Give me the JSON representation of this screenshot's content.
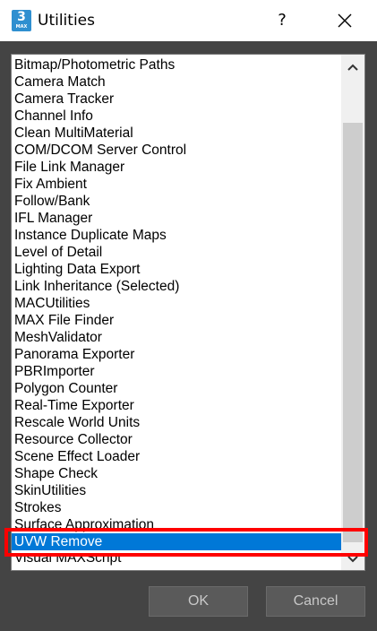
{
  "window": {
    "title": "Utilities",
    "help_label": "?",
    "app_icon": {
      "number": "3",
      "text": "MAX"
    }
  },
  "list": {
    "items": [
      "Bitmap/Photometric Paths",
      "Camera Match",
      "Camera Tracker",
      "Channel Info",
      "Clean MultiMaterial",
      "COM/DCOM Server Control",
      "File Link Manager",
      "Fix Ambient",
      "Follow/Bank",
      "IFL Manager",
      "Instance Duplicate Maps",
      "Level of Detail",
      "Lighting Data Export",
      "Link Inheritance (Selected)",
      "MACUtilities",
      "MAX File Finder",
      "MeshValidator",
      "Panorama Exporter",
      "PBRImporter",
      "Polygon Counter",
      "Real-Time Exporter",
      "Rescale World Units",
      "Resource Collector",
      "Scene Effect Loader",
      "Shape Check",
      "SkinUtilities",
      "Strokes",
      "Surface Approximation",
      "UVW Remove",
      "Visual MAXScript"
    ],
    "selected": "UVW Remove"
  },
  "buttons": {
    "ok_label": "OK",
    "cancel_label": "Cancel"
  },
  "colors": {
    "selection": "#0078d7",
    "highlight_box": "#ff0000",
    "window_bg": "#444444"
  },
  "icons": {
    "close": "close-icon",
    "scroll_up": "chevron-up-icon",
    "scroll_down": "chevron-down-icon"
  }
}
